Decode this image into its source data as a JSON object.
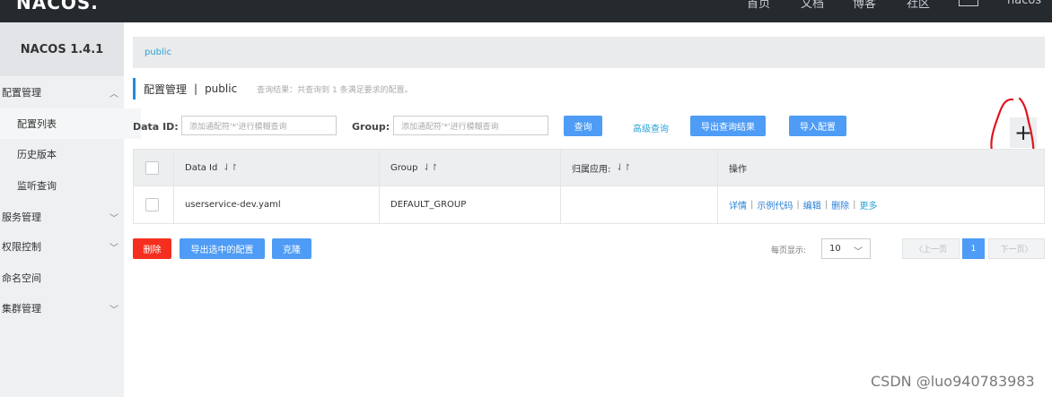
{
  "topbar": {
    "logo": "NACOS.",
    "nav": [
      "首页",
      "文档",
      "博客",
      "社区"
    ],
    "user": "nacos"
  },
  "sidebar": {
    "brand": "NACOS 1.4.1",
    "items": [
      {
        "label": "配置管理",
        "level": "top",
        "expanded": true
      },
      {
        "label": "配置列表",
        "level": "sub",
        "active": true
      },
      {
        "label": "历史版本",
        "level": "sub"
      },
      {
        "label": "监听查询",
        "level": "sub"
      },
      {
        "label": "服务管理",
        "level": "top",
        "expanded": false
      },
      {
        "label": "权限控制",
        "level": "top",
        "expanded": false
      },
      {
        "label": "命名空间",
        "level": "top"
      },
      {
        "label": "集群管理",
        "level": "top",
        "expanded": false
      }
    ]
  },
  "breadcrumb": "public",
  "page": {
    "title": "配置管理",
    "separator": "|",
    "namespace": "public",
    "result_hint": "查询结果：共查询到 1 条满足要求的配置。"
  },
  "search": {
    "dataid_label": "Data ID:",
    "dataid_placeholder": "添加通配符'*'进行模糊查询",
    "group_label": "Group:",
    "group_placeholder": "添加通配符'*'进行模糊查询",
    "query_btn": "查询",
    "advanced_link": "高级查询",
    "export_btn": "导出查询结果",
    "import_btn": "导入配置",
    "add_btn": "+"
  },
  "table": {
    "headers": [
      "Data Id",
      "Group",
      "归属应用:",
      "操作"
    ],
    "sort_icon": "⇃↾",
    "rows": [
      {
        "data_id": "userservice-dev.yaml",
        "group": "DEFAULT_GROUP",
        "app": "",
        "ops": [
          "详情",
          "示例代码",
          "编辑",
          "删除",
          "更多"
        ]
      }
    ]
  },
  "actions": {
    "delete_btn": "删除",
    "export_selected_btn": "导出选中的配置",
    "clone_btn": "克隆"
  },
  "pagination": {
    "page_size_label": "每页显示:",
    "page_size": "10",
    "prev": "上一页",
    "current": "1",
    "next": "下一页"
  },
  "watermark": "CSDN @luo940783983",
  "colors": {
    "topbar": "#252a2f",
    "primary": "#4e9cf5",
    "danger": "#f52f1f",
    "link": "#2aa3d6",
    "annotation": "#e0141e"
  }
}
